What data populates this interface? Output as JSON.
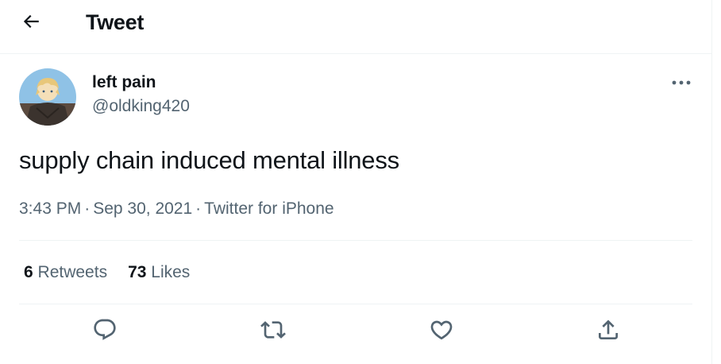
{
  "header": {
    "title": "Tweet",
    "back_icon": "arrow-left-icon"
  },
  "author": {
    "display_name": "left pain",
    "handle": "@oldking420",
    "avatar_desc_icon": "avatar-image"
  },
  "tweet": {
    "text": "supply chain induced mental illness",
    "time": "3:43 PM",
    "date": "Sep 30, 2021",
    "source": "Twitter for iPhone",
    "separator": "·"
  },
  "stats": {
    "retweets_count": "6",
    "retweets_label": "Retweets",
    "likes_count": "73",
    "likes_label": "Likes"
  },
  "actions": {
    "reply_icon": "reply-icon",
    "retweet_icon": "retweet-icon",
    "like_icon": "heart-icon",
    "share_icon": "share-icon"
  },
  "colors": {
    "text_primary": "#0f1419",
    "text_secondary": "#536471",
    "divider": "#eff3f4"
  }
}
